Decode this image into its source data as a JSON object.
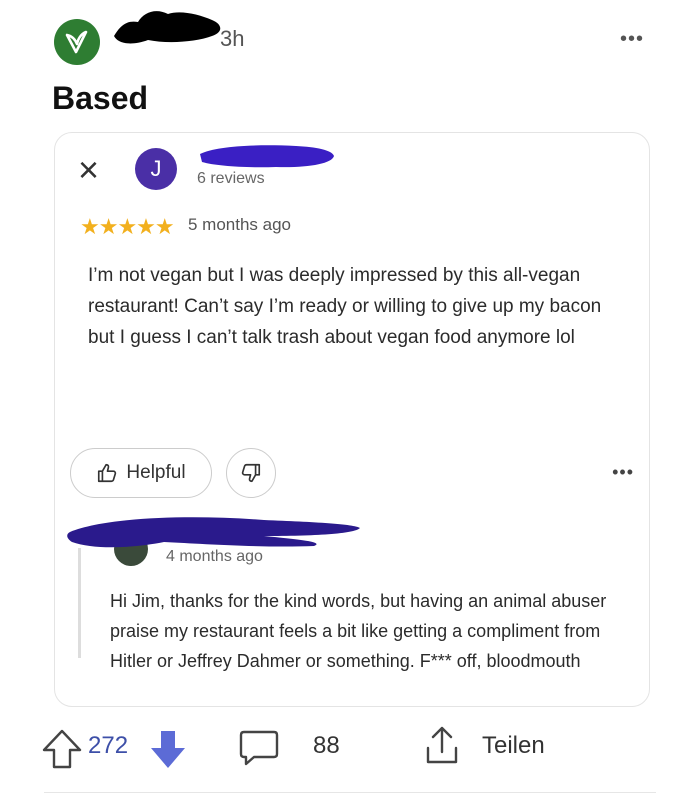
{
  "post": {
    "time_ago": "3h",
    "more_label": "•••",
    "title": "Based"
  },
  "review": {
    "close_label": "×",
    "avatar_initial": "J",
    "reviews_count": "6 reviews",
    "stars": "★★★★★",
    "rating": 5,
    "age": "5 months ago",
    "text": "I’m not vegan but I was deeply impressed by this all-vegan restaurant! Can’t say I’m ready or willing to give up my bacon but I guess I can’t talk trash about vegan food anymore lol",
    "helpful_label": "Helpful",
    "more_label": "•••"
  },
  "reply": {
    "age": "4 months ago",
    "text": "Hi Jim, thanks for the kind words, but having an animal abuser praise my restaurant feels a bit like getting a compliment from Hitler or Jeffrey Dahmer or something. F*** off, bloodmouth"
  },
  "actions": {
    "vote_count": "272",
    "comment_count": "88",
    "share_label": "Teilen"
  },
  "colors": {
    "vote_accent": "#3d4fa8",
    "star": "#f2b01e",
    "avatar_green": "#2e7d32",
    "reviewer_avatar": "#4a2fa6"
  }
}
